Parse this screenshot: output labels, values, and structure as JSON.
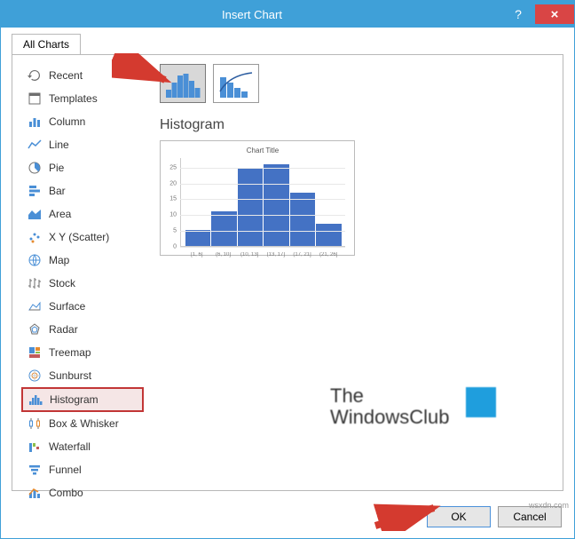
{
  "window": {
    "title": "Insert Chart",
    "help_tooltip": "?",
    "close_tooltip": "×"
  },
  "tabs": {
    "all_charts": "All Charts"
  },
  "sidebar": {
    "items": [
      {
        "label": "Recent"
      },
      {
        "label": "Templates"
      },
      {
        "label": "Column"
      },
      {
        "label": "Line"
      },
      {
        "label": "Pie"
      },
      {
        "label": "Bar"
      },
      {
        "label": "Area"
      },
      {
        "label": "X Y (Scatter)"
      },
      {
        "label": "Map"
      },
      {
        "label": "Stock"
      },
      {
        "label": "Surface"
      },
      {
        "label": "Radar"
      },
      {
        "label": "Treemap"
      },
      {
        "label": "Sunburst"
      },
      {
        "label": "Histogram"
      },
      {
        "label": "Box & Whisker"
      },
      {
        "label": "Waterfall"
      },
      {
        "label": "Funnel"
      },
      {
        "label": "Combo"
      }
    ]
  },
  "main": {
    "subtype_name": "Histogram",
    "preview_title": "Chart Title"
  },
  "chart_data": {
    "type": "bar",
    "title": "Chart Title",
    "xlabel": "",
    "ylabel": "",
    "ylim": [
      0,
      28
    ],
    "yticks": [
      0,
      5,
      10,
      15,
      20,
      25
    ],
    "categories": [
      "[1, 6]",
      "(6, 10]",
      "(10, 13]",
      "(13, 17]",
      "(17, 21]",
      "(21, 26]"
    ],
    "values": [
      5,
      11,
      25,
      26,
      17,
      7
    ]
  },
  "buttons": {
    "ok": "OK",
    "cancel": "Cancel"
  },
  "watermark": {
    "line1": "The",
    "line2": "WindowsClub"
  },
  "credit": "wsxdn.com"
}
